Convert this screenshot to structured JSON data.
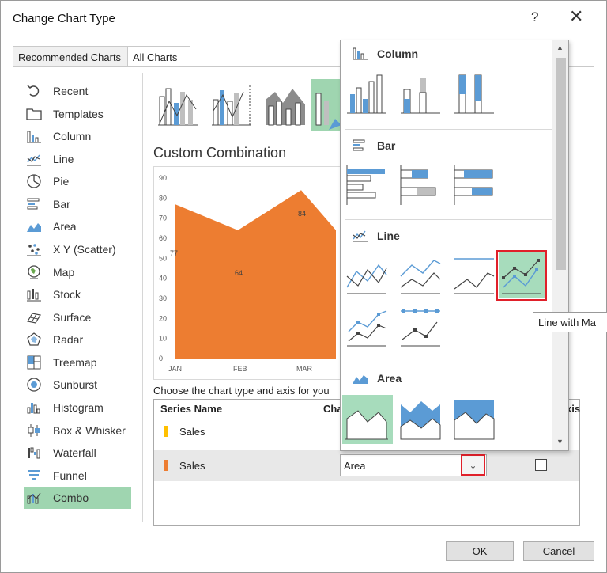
{
  "window": {
    "title": "Change Chart Type",
    "help": "?",
    "close": "✕"
  },
  "tabs": [
    {
      "label": "Recommended Charts"
    },
    {
      "label": "All Charts"
    }
  ],
  "sidebar": {
    "items": [
      {
        "label": "Recent",
        "icon": "recent-icon"
      },
      {
        "label": "Templates",
        "icon": "folder-icon"
      },
      {
        "label": "Column",
        "icon": "column-chart-icon"
      },
      {
        "label": "Line",
        "icon": "line-chart-icon"
      },
      {
        "label": "Pie",
        "icon": "pie-chart-icon"
      },
      {
        "label": "Bar",
        "icon": "bar-chart-icon"
      },
      {
        "label": "Area",
        "icon": "area-chart-icon"
      },
      {
        "label": "X Y (Scatter)",
        "icon": "scatter-chart-icon"
      },
      {
        "label": "Map",
        "icon": "map-icon"
      },
      {
        "label": "Stock",
        "icon": "stock-chart-icon"
      },
      {
        "label": "Surface",
        "icon": "surface-chart-icon"
      },
      {
        "label": "Radar",
        "icon": "radar-chart-icon"
      },
      {
        "label": "Treemap",
        "icon": "treemap-icon"
      },
      {
        "label": "Sunburst",
        "icon": "sunburst-icon"
      },
      {
        "label": "Histogram",
        "icon": "histogram-icon"
      },
      {
        "label": "Box & Whisker",
        "icon": "box-whisker-icon"
      },
      {
        "label": "Waterfall",
        "icon": "waterfall-icon"
      },
      {
        "label": "Funnel",
        "icon": "funnel-icon"
      },
      {
        "label": "Combo",
        "icon": "combo-chart-icon"
      }
    ],
    "selected": "Combo"
  },
  "main": {
    "section_title": "Custom Combination",
    "choose_text": "Choose the chart type and axis for you",
    "table": {
      "headers": [
        "Series Name",
        "Cha",
        "xis"
      ],
      "rows": [
        {
          "name": "Sales",
          "color": "#ffc000"
        },
        {
          "name": "Sales",
          "color": "#ed7d31",
          "chart_type": "Area"
        }
      ]
    }
  },
  "chart_data": {
    "type": "area",
    "categories": [
      "JAN",
      "FEB",
      "MAR"
    ],
    "values": [
      77,
      64,
      84
    ],
    "ylim": [
      0,
      90
    ],
    "yticks": [
      "0",
      "10",
      "20",
      "30",
      "40",
      "50",
      "60",
      "70",
      "80",
      "90"
    ],
    "data_labels": [
      "77",
      "64",
      "84"
    ],
    "color": "#ed7d31"
  },
  "popup": {
    "sections": [
      {
        "title": "Column",
        "icon": "column-chart-icon"
      },
      {
        "title": "Bar",
        "icon": "bar-chart-icon"
      },
      {
        "title": "Line",
        "icon": "line-chart-icon"
      },
      {
        "title": "Area",
        "icon": "area-chart-icon"
      }
    ],
    "tooltip": "Line with Ma"
  },
  "buttons": {
    "ok": "OK",
    "cancel": "Cancel"
  },
  "scroll": {
    "up": "▲",
    "down": "▼"
  }
}
